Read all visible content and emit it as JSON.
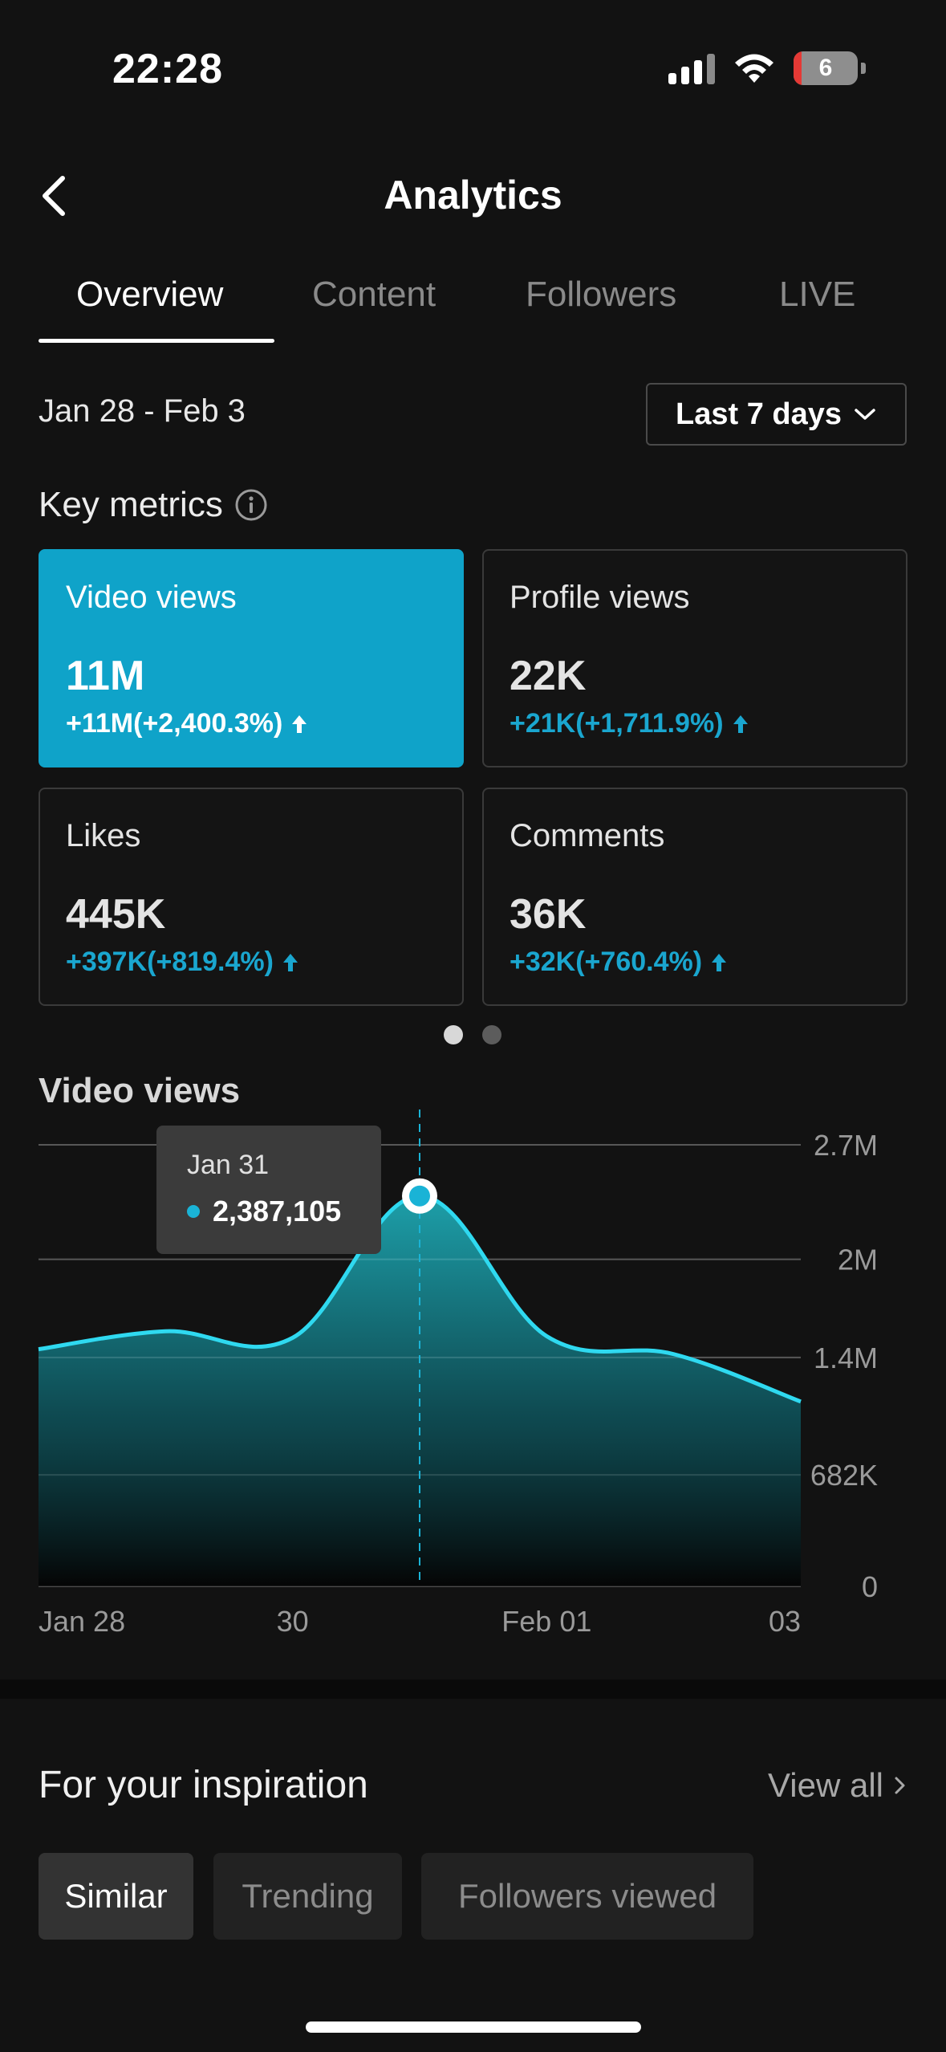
{
  "status_bar": {
    "time": "22:28",
    "battery": "6"
  },
  "header": {
    "title": "Analytics"
  },
  "tabs": [
    {
      "label": "Overview"
    },
    {
      "label": "Content"
    },
    {
      "label": "Followers"
    },
    {
      "label": "LIVE"
    }
  ],
  "active_tab": "Overview",
  "date_range": "Jan 28 - Feb 3",
  "range_select": {
    "label": "Last 7 days"
  },
  "key_metrics": {
    "title": "Key metrics",
    "cards": [
      {
        "label": "Video views",
        "value": "11M",
        "delta": "+11M(+2,400.3%)",
        "selected": true
      },
      {
        "label": "Profile views",
        "value": "22K",
        "delta": "+21K(+1,711.9%)",
        "selected": false
      },
      {
        "label": "Likes",
        "value": "445K",
        "delta": "+397K(+819.4%)",
        "selected": false
      },
      {
        "label": "Comments",
        "value": "36K",
        "delta": "+32K(+760.4%)",
        "selected": false
      }
    ],
    "pages": 2,
    "current_page": 1
  },
  "chart_title": "Video views",
  "tooltip": {
    "date": "Jan 31",
    "value": "2,387,105"
  },
  "chart_data": {
    "type": "area",
    "title": "Video views",
    "x": [
      "Jan 28",
      "Jan 29",
      "Jan 30",
      "Jan 31",
      "Feb 01",
      "Feb 02",
      "Feb 03"
    ],
    "values": [
      1450000,
      1560000,
      1520000,
      2387105,
      1530000,
      1420000,
      1130000
    ],
    "x_tick_labels": [
      "Jan 28",
      "30",
      "Feb 01",
      "03"
    ],
    "y_tick_labels": [
      "2.7M",
      "2M",
      "1.4M",
      "682K",
      "0"
    ],
    "y_ticks": [
      2700000,
      2000000,
      1400000,
      682000,
      0
    ],
    "ylim": [
      0,
      2700000
    ],
    "highlight_index": 3,
    "color": "#2fd9f0",
    "grid": true
  },
  "inspiration": {
    "title": "For your inspiration",
    "view_all": "View all",
    "chips": [
      {
        "label": "Similar",
        "active": true
      },
      {
        "label": "Trending",
        "active": false
      },
      {
        "label": "Followers viewed",
        "active": false
      }
    ]
  }
}
